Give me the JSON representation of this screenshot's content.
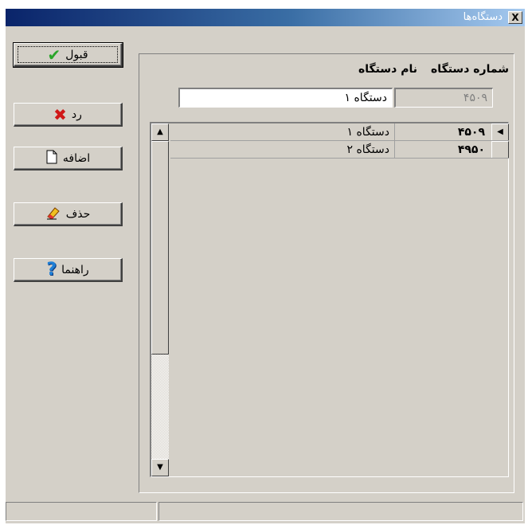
{
  "window": {
    "title": "دستگاه‌ها",
    "close_symbol": "X"
  },
  "buttons": {
    "accept": {
      "label": "قبول",
      "icon": "checkmark-icon",
      "color": "#2aa52a"
    },
    "reject": {
      "label": "رد",
      "icon": "x-icon",
      "color": "#d01818"
    },
    "add": {
      "label": "اضافه",
      "icon": "new-document-icon"
    },
    "delete": {
      "label": "حذف",
      "icon": "eraser-icon"
    },
    "help": {
      "label": "راهنما",
      "icon": "question-icon",
      "color": "#1f7fd6"
    }
  },
  "header": {
    "number_label": "شماره دستگاه",
    "name_label": "نام دستگاه"
  },
  "fields": {
    "number_value": "۴۵۰۹",
    "name_value": "دستگاه ۱"
  },
  "grid": {
    "rows": [
      {
        "number": "۴۵۰۹",
        "name": "دستگاه ۱",
        "current": true
      },
      {
        "number": "۴۹۵۰",
        "name": "دستگاه ۲",
        "current": false
      }
    ]
  }
}
